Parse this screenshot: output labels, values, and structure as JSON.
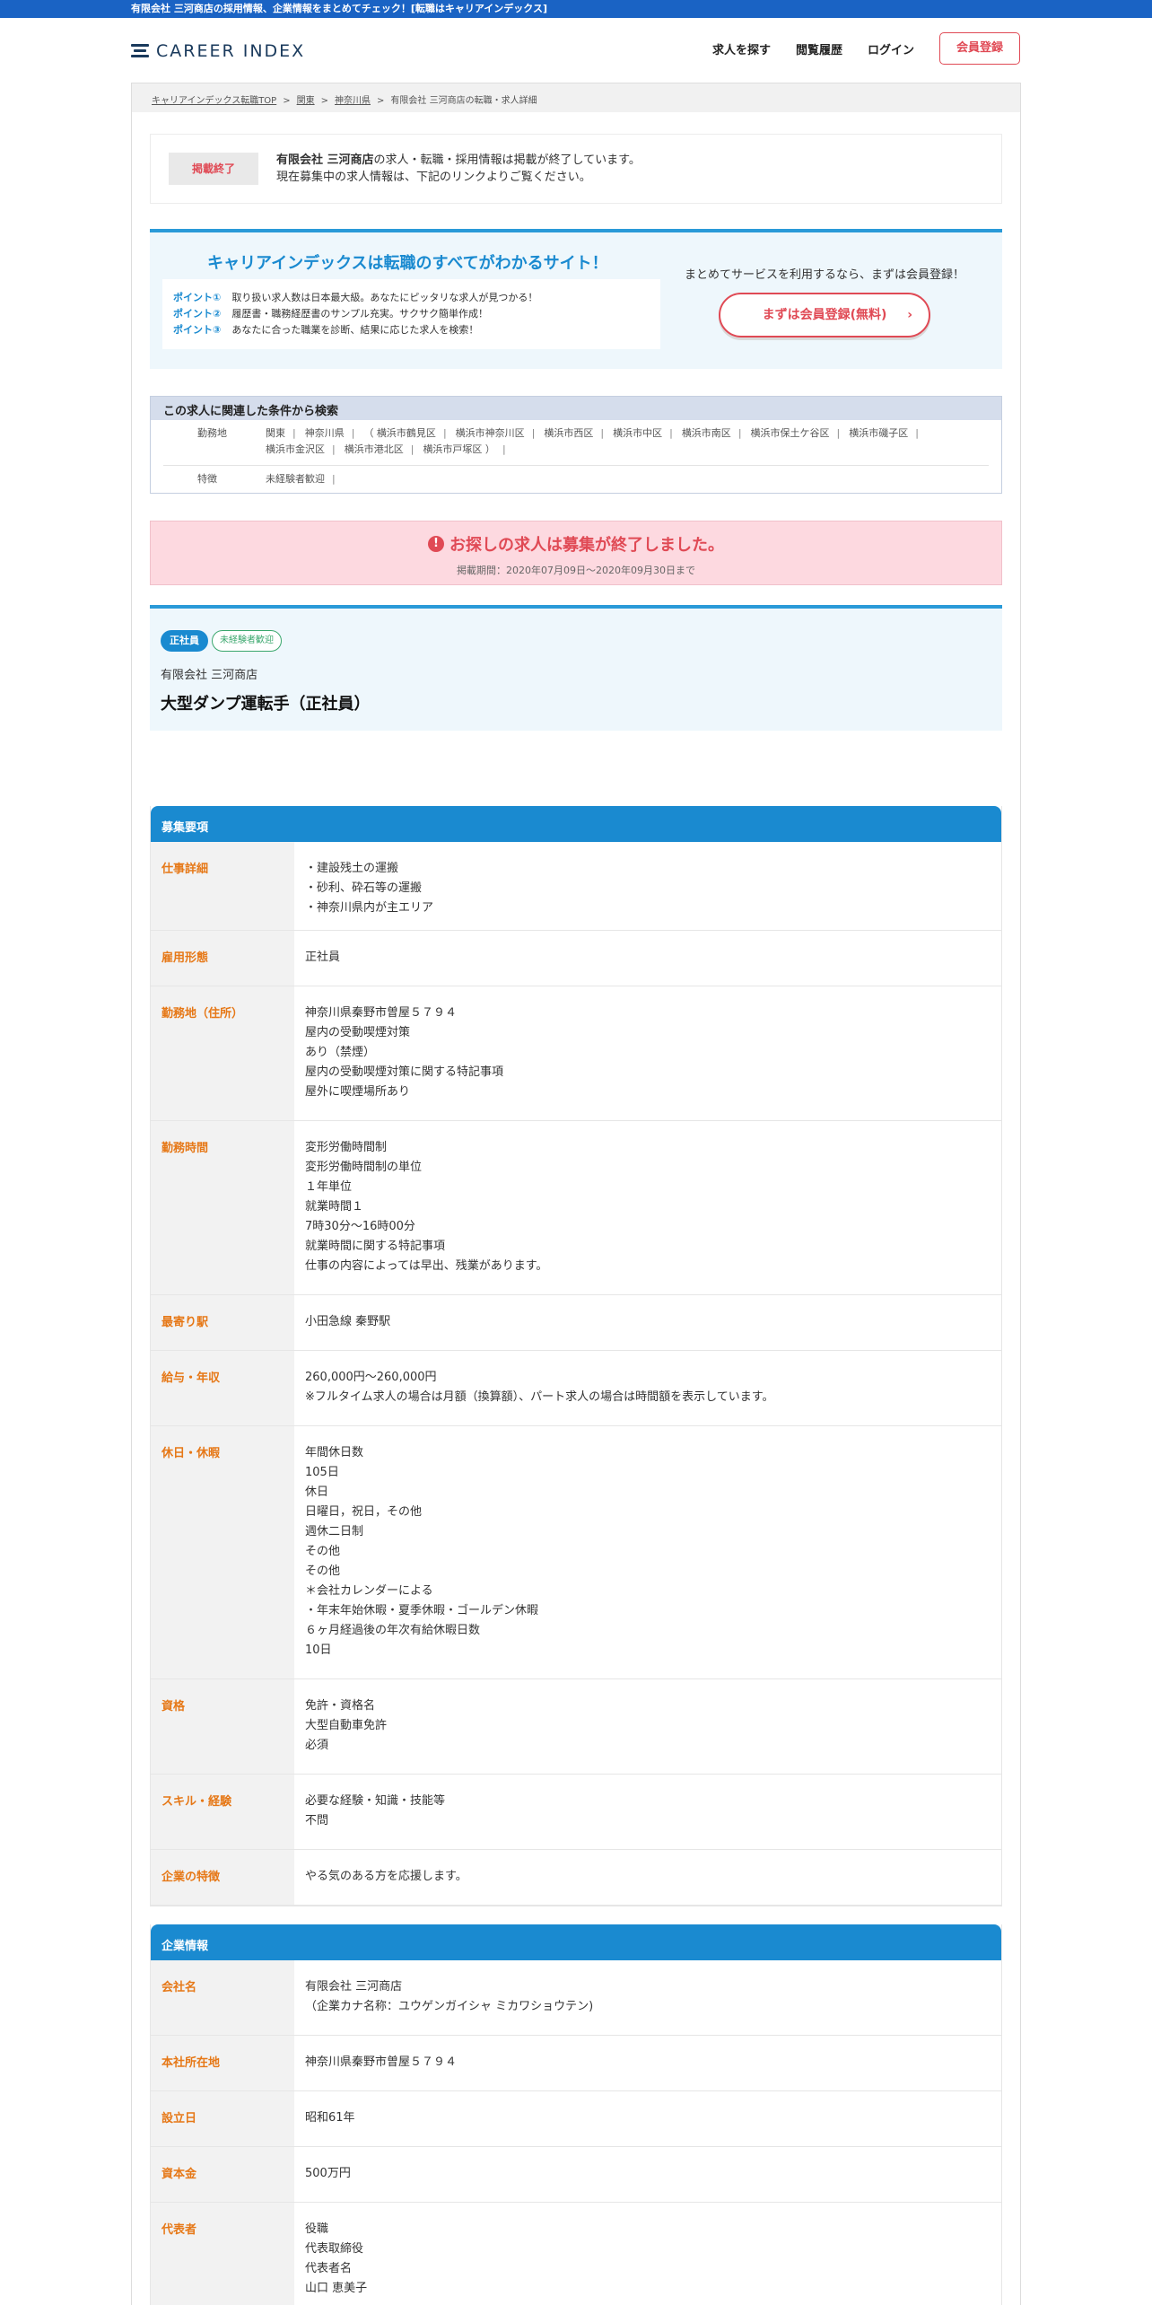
{
  "topbar": {
    "text": "有限会社 三河商店の採用情報、企業情報をまとめてチェック！[転職はキャリアインデックス]"
  },
  "header": {
    "logo": "CAREER INDEX",
    "nav": [
      "求人を探す",
      "閲覧履歴",
      "ログイン"
    ],
    "register": "会員登録"
  },
  "breadcrumb": [
    {
      "label": "キャリアインデックス転職TOP",
      "link": true
    },
    {
      "label": "関東",
      "link": true
    },
    {
      "label": "神奈川県",
      "link": true
    },
    {
      "label": "有限会社 三河商店の転職・求人詳細",
      "link": false
    }
  ],
  "ended": {
    "badge": "掲載終了",
    "company": "有限会社 三河商店",
    "line1_rest": "の求人・転職・採用情報は掲載が終了しています。",
    "line2": "現在募集中の求人情報は、下記のリンクよりご覧ください。"
  },
  "promo": {
    "title": "キャリアインデックスは転職のすべてがわかるサイト！",
    "points": [
      {
        "key": "ポイント①",
        "text": "取り扱い求人数は日本最大級。あなたにピッタリな求人が見つかる！"
      },
      {
        "key": "ポイント②",
        "text": "履歴書・職務経歴書のサンプル充実。サクサク簡単作成！"
      },
      {
        "key": "ポイント③",
        "text": "あなたに合った職業を診断、結果に応じた求人を検索！"
      }
    ],
    "right_text": "まとめてサービスを利用するなら、まずは会員登録！",
    "button": "まずは会員登録(無料)",
    "button_arrow": "›"
  },
  "related": {
    "title": "この求人に関連した条件から検索",
    "location_label": "勤務地",
    "locations": [
      "関東",
      "神奈川県",
      "（ 横浜市鶴見区",
      "横浜市神奈川区",
      "横浜市西区",
      "横浜市中区",
      "横浜市南区",
      "横浜市保土ケ谷区",
      "横浜市磯子区",
      "横浜市金沢区",
      "横浜市港北区",
      "横浜市戸塚区 ）"
    ],
    "feature_label": "特徴",
    "features": [
      "未経験者歓迎"
    ]
  },
  "closed": {
    "icon": "!",
    "title": "お探しの求人は募集が終了しました。",
    "period": "掲載期間：2020年07月09日〜2020年09月30日まで"
  },
  "job": {
    "tags": [
      "正社員",
      "未経験者歓迎"
    ],
    "company": "有限会社 三河商店",
    "title": "大型ダンプ運転手（正社員）"
  },
  "recruit": {
    "heading": "募集要項",
    "rows": [
      {
        "key": "仕事詳細",
        "lines": [
          "・建設残土の運搬",
          "・砂利、砕石等の運搬",
          "・神奈川県内が主エリア"
        ]
      },
      {
        "key": "雇用形態",
        "lines": [
          "正社員"
        ]
      },
      {
        "key": "勤務地（住所）",
        "lines": [
          "神奈川県秦野市曽屋５７９４",
          "屋内の受動喫煙対策",
          "あり（禁煙）",
          "屋内の受動喫煙対策に関する特記事項",
          "屋外に喫煙場所あり"
        ]
      },
      {
        "key": "勤務時間",
        "lines": [
          "変形労働時間制",
          "変形労働時間制の単位",
          "１年単位",
          "就業時間１",
          "7時30分〜16時00分",
          "就業時間に関する特記事項",
          "仕事の内容によっては早出、残業があります。"
        ]
      },
      {
        "key": "最寄り駅",
        "lines": [
          "小田急線 秦野駅"
        ]
      },
      {
        "key": "給与・年収",
        "lines": [
          "260,000円〜260,000円",
          "※フルタイム求人の場合は月額（換算額）、パート求人の場合は時間額を表示しています。"
        ]
      },
      {
        "key": "休日・休暇",
        "lines": [
          "年間休日数",
          "105日",
          "休日",
          "日曜日，祝日，その他",
          "週休二日制",
          "その他",
          "その他",
          "＊会社カレンダーによる",
          "・年末年始休暇・夏季休暇・ゴールデン休暇",
          "６ヶ月経過後の年次有給休暇日数",
          "10日"
        ]
      },
      {
        "key": "資格",
        "lines": [
          "免許・資格名",
          "大型自動車免許",
          "必須"
        ]
      },
      {
        "key": "スキル・経験",
        "lines": [
          "必要な経験・知識・技能等",
          "不問"
        ]
      },
      {
        "key": "企業の特徴",
        "lines": [
          "やる気のある方を応援します。"
        ]
      }
    ]
  },
  "company": {
    "heading": "企業情報",
    "rows": [
      {
        "key": "会社名",
        "lines": [
          "有限会社 三河商店",
          "（企業カナ名称：ユウゲンガイシャ ミカワショウテン)"
        ]
      },
      {
        "key": "本社所在地",
        "lines": [
          "神奈川県秦野市曽屋５７９４"
        ]
      },
      {
        "key": "設立日",
        "lines": [
          "昭和61年"
        ]
      },
      {
        "key": "資本金",
        "lines": [
          "500万円"
        ]
      },
      {
        "key": "代表者",
        "lines": [
          "役職",
          "代表取締役",
          "代表者名",
          "山口 恵美子"
        ]
      }
    ]
  }
}
